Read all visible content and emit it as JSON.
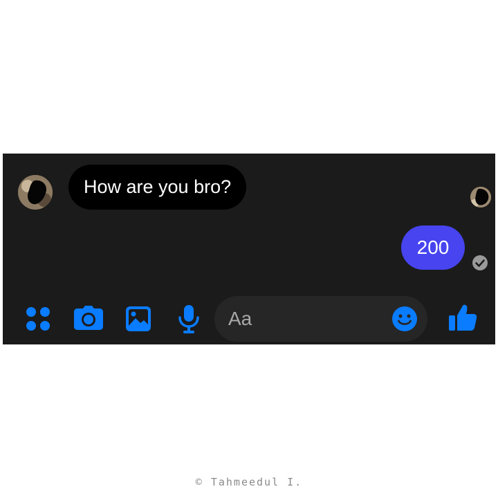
{
  "conversation": {
    "incoming_message": "How are you bro?",
    "outgoing_message": "200"
  },
  "composer": {
    "placeholder": "Aa"
  },
  "toolbar": {
    "icons": [
      "menu-dots-icon",
      "camera-icon",
      "gallery-icon",
      "microphone-icon",
      "emoji-icon",
      "thumbs-up-icon"
    ]
  },
  "colors": {
    "panel_background": "#1b1b1b",
    "incoming_bubble": "#000000",
    "outgoing_bubble": "#4744f0",
    "accent_icon": "#0a7cff",
    "composer_background": "#262626"
  },
  "footer": {
    "credit": "© Tahmeedul I."
  }
}
